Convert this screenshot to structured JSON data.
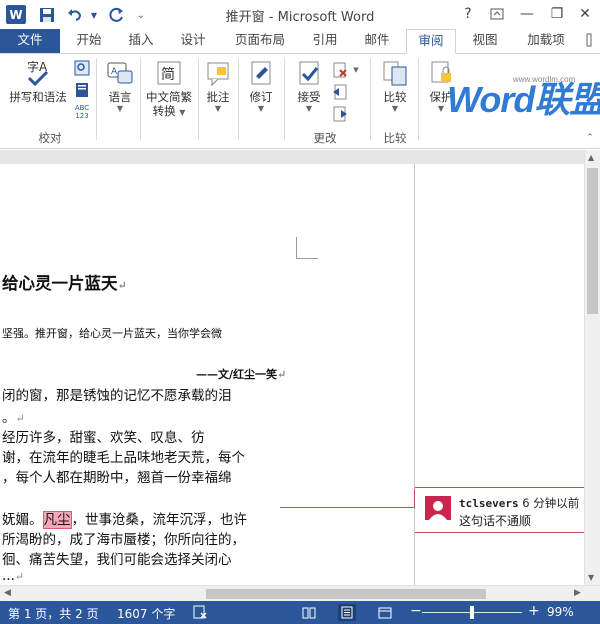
{
  "window": {
    "title": "推开窗 - Microsoft Word",
    "logo_letter": "W",
    "help": "?",
    "minimize": "—",
    "restore": "❐",
    "close": "✕"
  },
  "quick_access": {
    "save_icon": "save-icon",
    "undo_icon": "undo-icon",
    "redo_icon": "redo-icon",
    "customize_icon": "chevron-down-icon"
  },
  "tabs": [
    {
      "label": "文件"
    },
    {
      "label": "开始"
    },
    {
      "label": "插入"
    },
    {
      "label": "设计"
    },
    {
      "label": "页面布局"
    },
    {
      "label": "引用"
    },
    {
      "label": "邮件"
    },
    {
      "label": "审阅"
    },
    {
      "label": "视图"
    },
    {
      "label": "加载项"
    }
  ],
  "ribbon": {
    "proofing": {
      "spelling_label": "拼写和语法",
      "group_label": "校对"
    },
    "language_label": "语言",
    "chinese_conv_label_1": "中文简繁",
    "chinese_conv_label_2": "转换",
    "comments_label": "批注",
    "tracking_label": "修订",
    "changes": {
      "accept_label": "接受",
      "group_label": "更改"
    },
    "compare": {
      "compare_label": "比较",
      "group_label": "比较"
    },
    "protect_label": "保护"
  },
  "watermark": {
    "text_latin": "Word",
    "text_cn": "联盟",
    "url": "www.wordlm.com"
  },
  "document": {
    "heading": "给心灵一片蓝天",
    "line1": "坚强。推开窗，给心灵一片蓝天，当你学会微",
    "byline": "——文/红尘一笑",
    "line2": "闭的窗，那是锈蚀的记忆不愿承载的泪",
    "line3": "。",
    "line4": "经历许多，甜蜜、欢笑、叹息、彷",
    "line5": "谢，在流年的睫毛上品味地老天荒，每个",
    "line6": "，每个人都在期盼中，翘首一份幸福绵",
    "line7_pre": "妩媚。",
    "line7_hl": "凡尘",
    "line7_post": "，世事沧桑，流年沉浮，也许",
    "line8": "所渴盼的，成了海市蜃楼；你所向往的，",
    "line9": "徊、痛苦失望，我们可能会选择关闭心",
    "line10": "..."
  },
  "comment": {
    "author": "tclsevers",
    "time": "6 分钟以前",
    "text": "这句话不通顺"
  },
  "status": {
    "page": "第 1 页，共 2 页",
    "words": "1607 个字",
    "zoom": "99%",
    "zoom_minus": "−",
    "zoom_plus": "+"
  }
}
